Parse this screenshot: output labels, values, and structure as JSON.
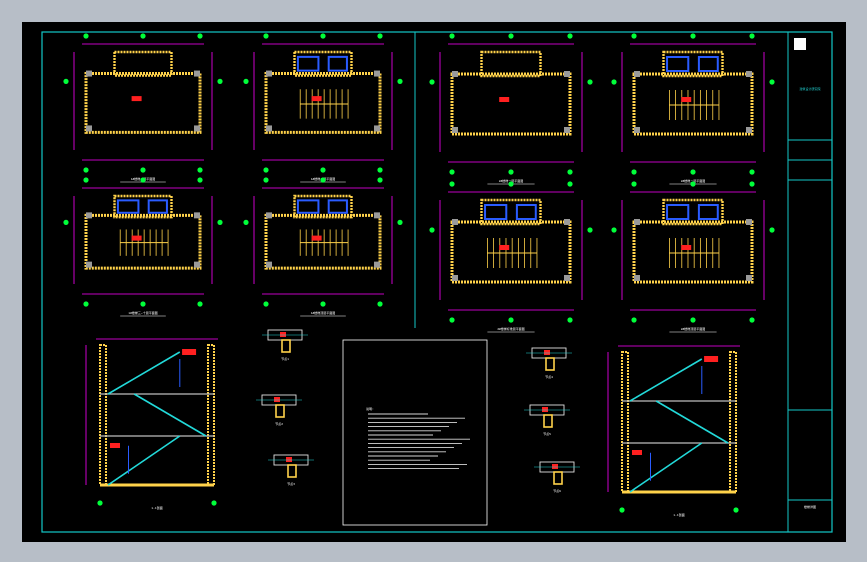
{
  "colors": {
    "background": "#000000",
    "window": "#b7bec7",
    "border": "#13c7c7",
    "grid": "#ff00ff",
    "wall": "#ffd24a",
    "stair": "#ffd24a",
    "note": "#ff2020",
    "blue": "#2a5cff",
    "label": "#ffffff",
    "axis_marker": "#00ff3a"
  },
  "drawing": {
    "plans": [
      {
        "label": "1#楼梯一层平面图"
      },
      {
        "label": "1#楼梯二层平面图"
      },
      {
        "label": "1#楼梯三~十层平面图"
      },
      {
        "label": "1#楼梯顶层平面图"
      },
      {
        "label": "2#楼梯一层平面图"
      },
      {
        "label": "2#楼梯二层平面图"
      },
      {
        "label": "2#楼梯标准层平面图"
      },
      {
        "label": "2#楼梯顶层平面图"
      }
    ],
    "sections": [
      {
        "label": "1-1剖面"
      },
      {
        "label": "1-1剖面"
      }
    ],
    "details": [
      {
        "label": "节点1"
      },
      {
        "label": "节点2"
      },
      {
        "label": "节点3"
      },
      {
        "label": "节点4"
      },
      {
        "label": "节点5"
      },
      {
        "label": "节点6"
      }
    ],
    "notes": {
      "title": "说明:"
    },
    "title_block": {
      "company": "建筑设计研究院",
      "project": "楼梯详图"
    }
  }
}
